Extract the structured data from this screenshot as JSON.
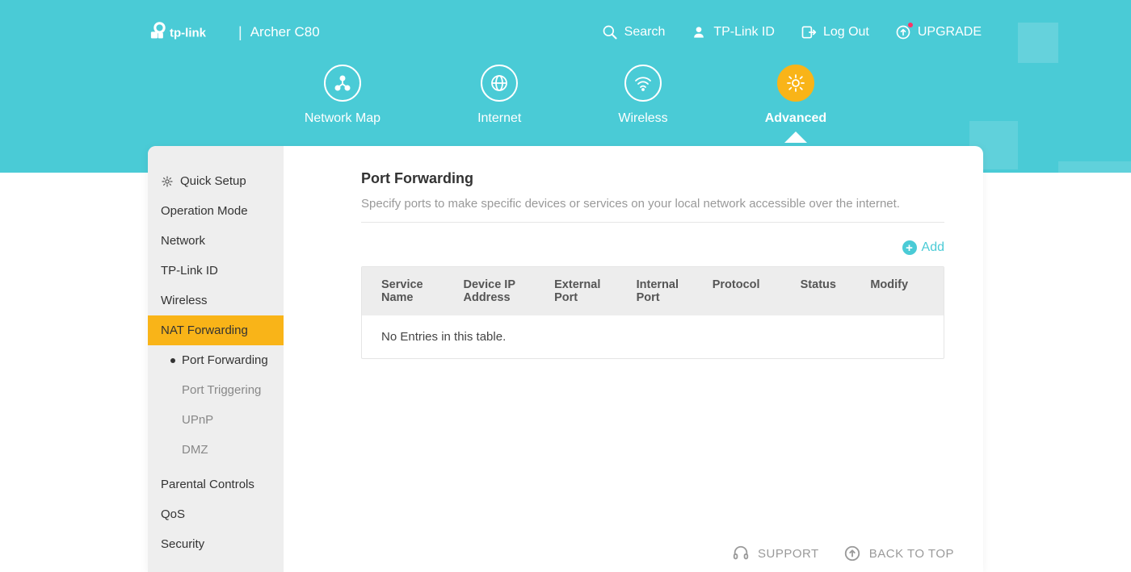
{
  "brand": "tp-link",
  "model": "Archer C80",
  "topActions": {
    "search": "Search",
    "tplinkId": "TP-Link ID",
    "logout": "Log Out",
    "upgrade": "UPGRADE"
  },
  "navTabs": {
    "networkMap": "Network Map",
    "internet": "Internet",
    "wireless": "Wireless",
    "advanced": "Advanced"
  },
  "sidebar": {
    "quickSetup": "Quick Setup",
    "operationMode": "Operation Mode",
    "network": "Network",
    "tplinkId": "TP-Link ID",
    "wireless": "Wireless",
    "natForwarding": "NAT Forwarding",
    "sub": {
      "portForwarding": "Port Forwarding",
      "portTriggering": "Port Triggering",
      "upnp": "UPnP",
      "dmz": "DMZ"
    },
    "parentalControls": "Parental Controls",
    "qos": "QoS",
    "security": "Security"
  },
  "content": {
    "title": "Port Forwarding",
    "description": "Specify ports to make specific devices or services on your local network accessible over the internet.",
    "addLabel": "Add",
    "columns": {
      "serviceName": "Service Name",
      "deviceIp": "Device IP Address",
      "externalPort": "External Port",
      "internalPort": "Internal Port",
      "protocol": "Protocol",
      "status": "Status",
      "modify": "Modify"
    },
    "emptyText": "No Entries in this table."
  },
  "footer": {
    "support": "SUPPORT",
    "backToTop": "BACK TO TOP"
  }
}
